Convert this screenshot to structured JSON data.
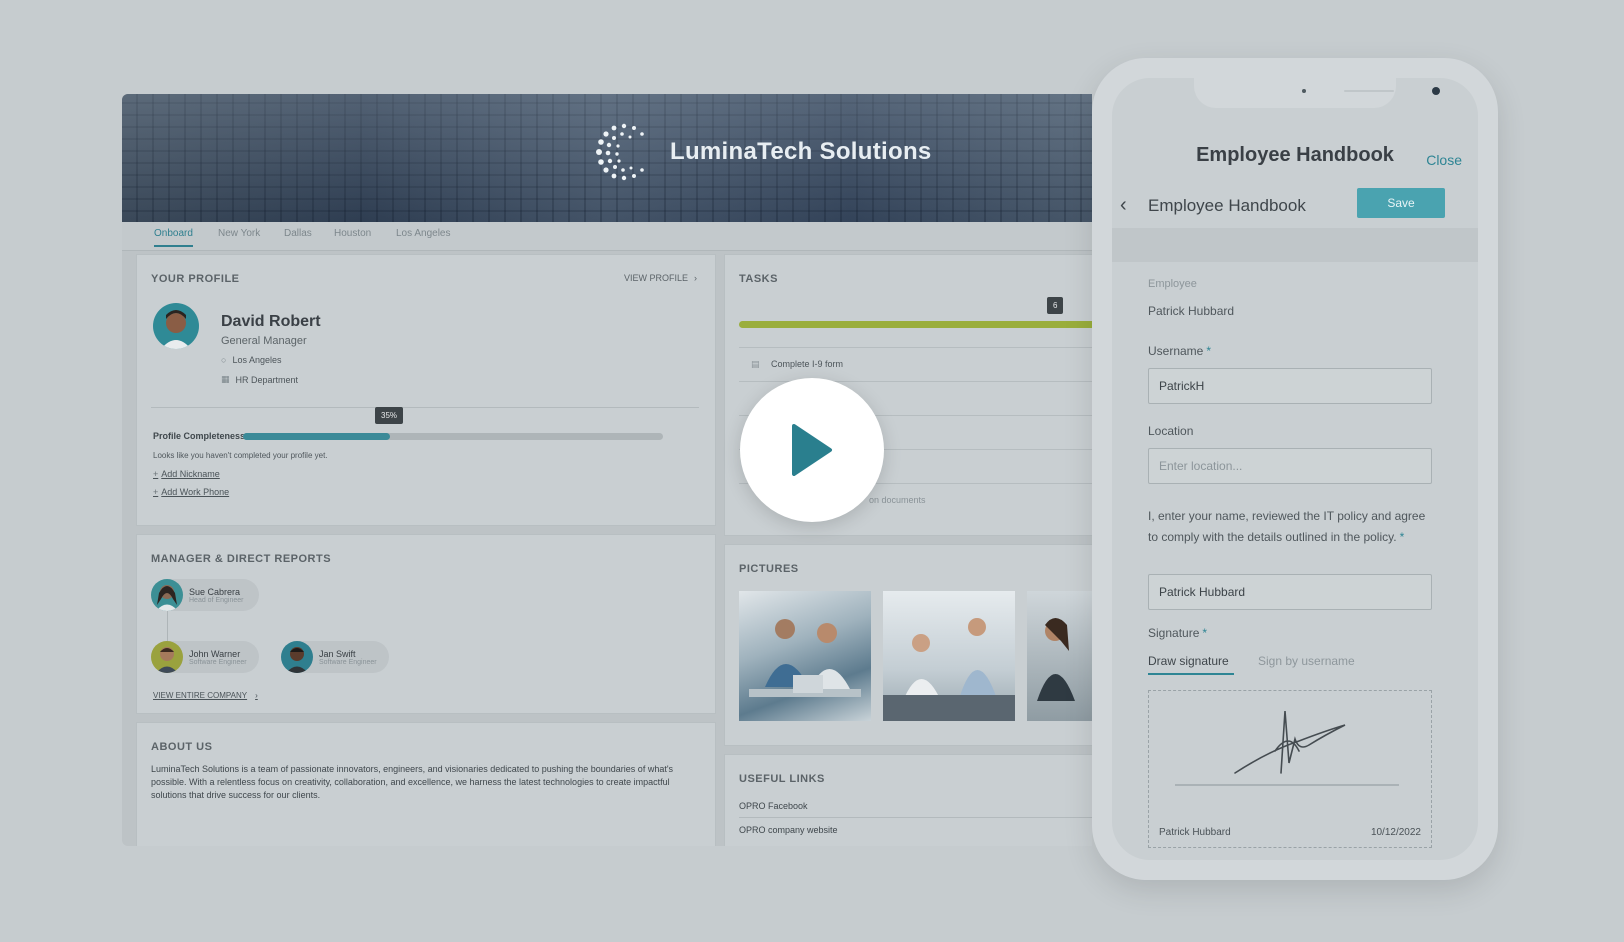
{
  "portal": {
    "company_name": "LuminaTech Solutions",
    "tabs": [
      "Onboard",
      "New York",
      "Dallas",
      "Houston",
      "Los Angeles"
    ],
    "profile": {
      "section_title": "YOUR PROFILE",
      "view_link": "VIEW PROFILE",
      "name": "David Robert",
      "role": "General Manager",
      "location": "Los Angeles",
      "department": "HR Department",
      "completeness_label": "Profile Completeness",
      "completeness_value": "35%",
      "completeness_fraction": 0.35,
      "hint": "Looks like you haven't completed your profile yet.",
      "links": [
        "Add Nickname",
        "Add Work Phone"
      ]
    },
    "manager": {
      "section_title": "MANAGER & DIRECT REPORTS",
      "people": [
        {
          "name": "Sue Cabrera",
          "role": "Head of Engineer"
        },
        {
          "name": "John Warner",
          "role": "Software Engineer"
        },
        {
          "name": "Jan Swift",
          "role": "Software Engineer"
        }
      ],
      "view_link": "VIEW ENTIRE COMPANY"
    },
    "about": {
      "section_title": "ABOUT US",
      "text": "LuminaTech Solutions is a team of passionate innovators, engineers, and visionaries dedicated to pushing the boundaries of what's possible. With a relentless focus on creativity, collaboration, and excellence, we harness the latest technologies to create impactful solutions that drive success for our clients."
    },
    "tasks": {
      "section_title": "TASKS",
      "progress_badge": "6",
      "items": [
        "Complete I-9 form",
        "",
        "",
        "e",
        "on documents"
      ]
    },
    "pictures": {
      "section_title": "PICTURES"
    },
    "useful_links": {
      "section_title": "USEFUL LINKS",
      "links": [
        "OPRO Facebook",
        "OPRO company website"
      ]
    }
  },
  "phone": {
    "title": "Employee Handbook",
    "close_label": "Close",
    "subtitle": "Employee Handbook",
    "save_label": "Save",
    "employee_label": "Employee",
    "employee_value": "Patrick Hubbard",
    "username_label": "Username",
    "username_value": "PatrickH",
    "location_label": "Location",
    "location_placeholder": "Enter location...",
    "agreement_text": "I, enter your name, reviewed the IT policy and agree to comply with the details outlined in the policy.",
    "agreement_value": "Patrick Hubbard",
    "signature_label": "Signature",
    "sig_tabs": [
      "Draw signature",
      "Sign by username"
    ],
    "signer_name": "Patrick Hubbard",
    "sign_date": "10/12/2022",
    "required_mark": "*"
  },
  "colors": {
    "accent": "#2e8594",
    "save_button": "#4aa3b0",
    "task_progress": "#9aae3c"
  },
  "icons": {
    "play": "play-icon",
    "back": "chevron-left-icon",
    "location": "map-pin-icon",
    "department": "building-icon"
  }
}
